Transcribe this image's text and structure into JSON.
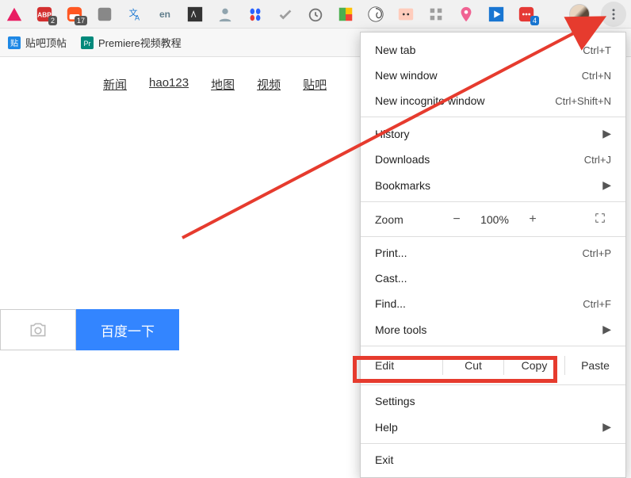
{
  "ext_badges": {
    "abp": "2",
    "red_box": "17",
    "blue_box": "4"
  },
  "bookmarks": {
    "item1": "贴吧顶帖",
    "item2": "Premiere视频教程"
  },
  "nav": {
    "news": "新闻",
    "hao123": "hao123",
    "map": "地图",
    "video": "视频",
    "tieba": "贴吧"
  },
  "search_button": "百度一下",
  "menu": {
    "new_tab": {
      "label": "New tab",
      "shortcut": "Ctrl+T"
    },
    "new_window": {
      "label": "New window",
      "shortcut": "Ctrl+N"
    },
    "new_incognito": {
      "label": "New incognito window",
      "shortcut": "Ctrl+Shift+N"
    },
    "history": {
      "label": "History"
    },
    "downloads": {
      "label": "Downloads",
      "shortcut": "Ctrl+J"
    },
    "bookmarks": {
      "label": "Bookmarks"
    },
    "zoom": {
      "label": "Zoom",
      "minus": "−",
      "pct": "100%",
      "plus": "+"
    },
    "print": {
      "label": "Print...",
      "shortcut": "Ctrl+P"
    },
    "cast": {
      "label": "Cast..."
    },
    "find": {
      "label": "Find...",
      "shortcut": "Ctrl+F"
    },
    "more_tools": {
      "label": "More tools"
    },
    "edit": {
      "label": "Edit",
      "cut": "Cut",
      "copy": "Copy",
      "paste": "Paste"
    },
    "settings": {
      "label": "Settings"
    },
    "help": {
      "label": "Help"
    },
    "exit": {
      "label": "Exit"
    }
  }
}
